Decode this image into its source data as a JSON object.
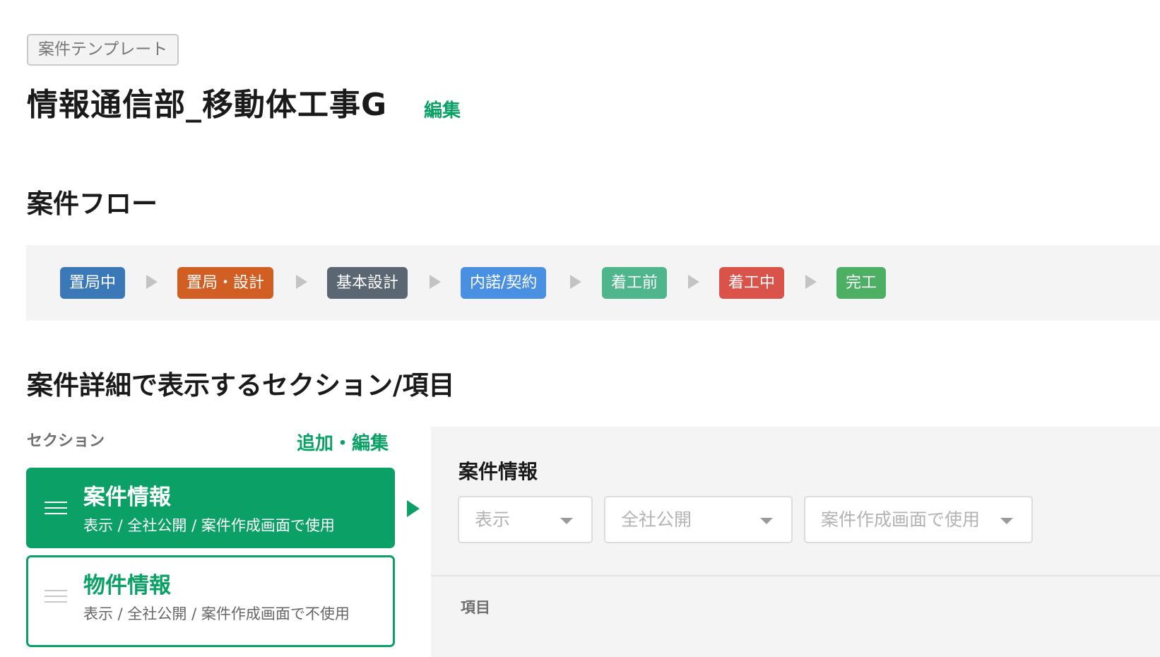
{
  "template_tag": "案件テンプレート",
  "title": "情報通信部_移動体工事G",
  "title_edit_link": "編集",
  "flow": {
    "heading": "案件フロー",
    "steps": [
      {
        "label": "置局中",
        "color": "#3a78b8"
      },
      {
        "label": "置局・設計",
        "color": "#d15f23"
      },
      {
        "label": "基本設計",
        "color": "#5a6672"
      },
      {
        "label": "内諾/契約",
        "color": "#4a90e2"
      },
      {
        "label": "着工前",
        "color": "#4fb58c"
      },
      {
        "label": "着工中",
        "color": "#d9534a"
      },
      {
        "label": "完工",
        "color": "#4caf64"
      }
    ]
  },
  "details": {
    "heading": "案件詳細で表示するセクション/項目",
    "section_column_label": "セクション",
    "add_edit_link": "追加・編集",
    "sections": [
      {
        "title": "案件情報",
        "subtitle": "表示 / 全社公開 / 案件作成画面で使用",
        "selected": true
      },
      {
        "title": "物件情報",
        "subtitle": "表示 / 全社公開 / 案件作成画面で不使用",
        "selected": false
      }
    ],
    "panel": {
      "title": "案件情報",
      "dropdowns": [
        {
          "value": "表示"
        },
        {
          "value": "全社公開"
        },
        {
          "value": "案件作成画面で使用"
        }
      ],
      "items_label": "項目"
    }
  },
  "colors": {
    "accent": "#0aa066",
    "panel_bg": "#f4f4f4"
  }
}
